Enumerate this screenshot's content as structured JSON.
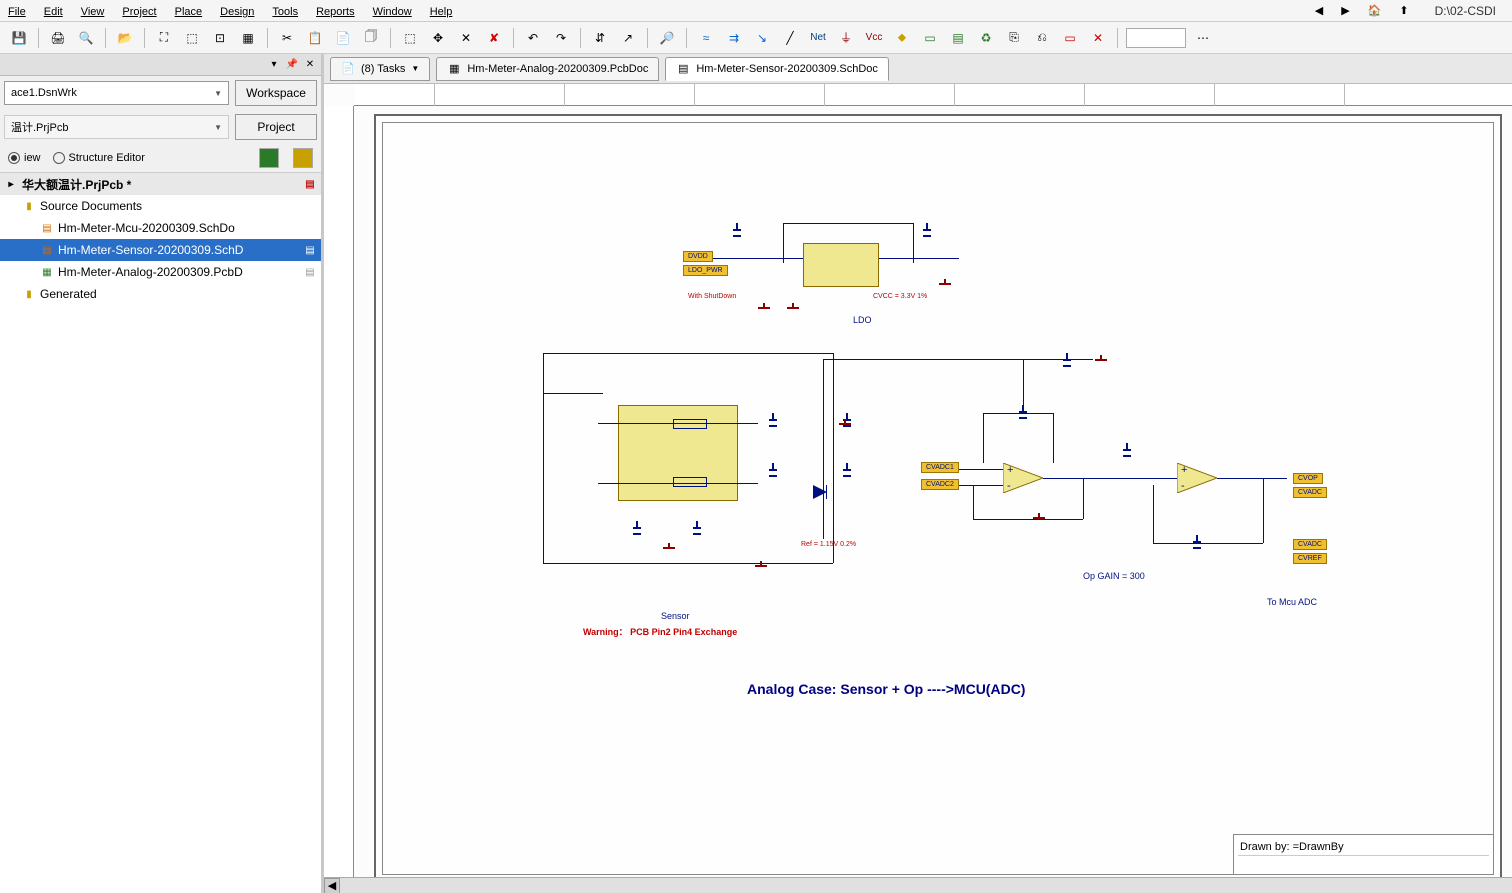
{
  "menubar": {
    "file": "File",
    "edit": "Edit",
    "view": "View",
    "project": "Project",
    "place": "Place",
    "design": "Design",
    "tools": "Tools",
    "reports": "Reports",
    "window": "Window",
    "help": "Help",
    "path": "D:\\02-CSDI"
  },
  "toolbar": {
    "net_label": "Net",
    "vcc_label": "Vcc"
  },
  "left": {
    "workspace_file": "ace1.DsnWrk",
    "workspace_btn": "Workspace",
    "project_file": "温计.PrjPcb",
    "project_btn": "Project",
    "view_label": "iew",
    "structure_label": "Structure Editor",
    "tree": {
      "project": "华大额温计.PrjPcb *",
      "source_docs": "Source Documents",
      "mcu": "Hm-Meter-Mcu-20200309.SchDo",
      "sensor": "Hm-Meter-Sensor-20200309.SchD",
      "analog": "Hm-Meter-Analog-20200309.PcbD",
      "generated": "Generated"
    }
  },
  "tabs": {
    "tasks": "(8) Tasks",
    "pcb": "Hm-Meter-Analog-20200309.PcbDoc",
    "sch": "Hm-Meter-Sensor-20200309.SchDoc"
  },
  "schematic": {
    "ldo_label": "LDO",
    "ldo_note": "CVCC = 3.3V 1%",
    "ldo_shutdown": "With ShutDown",
    "sensor_label": "Sensor",
    "sensor_warn": "Warning：  PCB Pin2 Pin4 Exchange",
    "ref_note": "Ref = 1.15V 0.2%",
    "op_label": "Op  GAIN = 300",
    "adc_label": "To Mcu ADC",
    "title": "Analog Case: Sensor + Op ---->MCU(ADC)",
    "drawn_by": "Drawn by:   =DrawnBy"
  }
}
